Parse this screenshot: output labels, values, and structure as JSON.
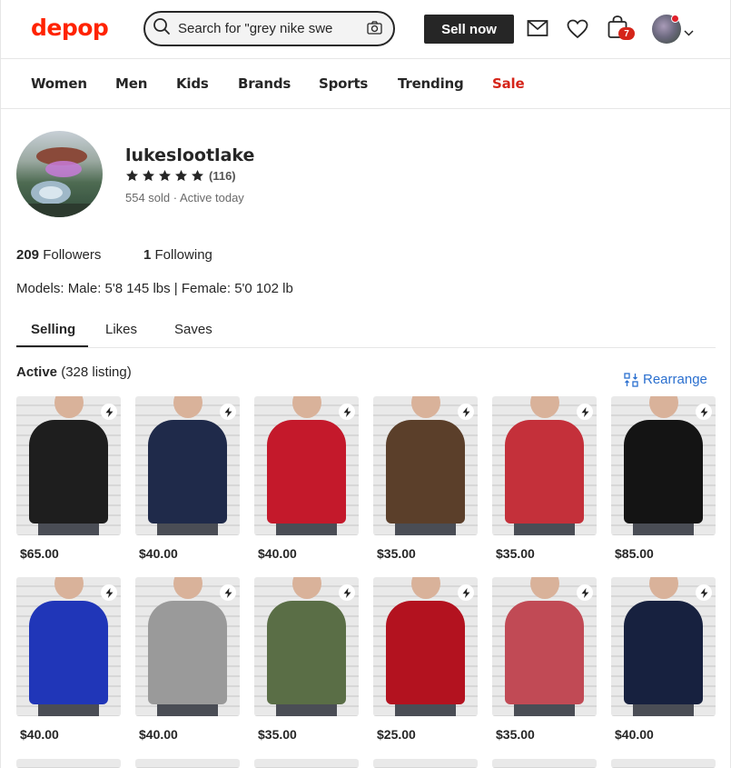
{
  "header": {
    "logo": "depop",
    "search_placeholder": "Search for \"grey nike swe",
    "sell_label": "Sell now",
    "bag_count": "7"
  },
  "categories": [
    {
      "label": "Women"
    },
    {
      "label": "Men"
    },
    {
      "label": "Kids"
    },
    {
      "label": "Brands"
    },
    {
      "label": "Sports"
    },
    {
      "label": "Trending"
    },
    {
      "label": "Sale"
    }
  ],
  "profile": {
    "username": "lukeslootlake",
    "rating_stars": 5,
    "rating_count": "(116)",
    "sold_line": "554 sold · Active today",
    "followers_count": "209",
    "followers_label": "Followers",
    "following_count": "1",
    "following_label": "Following",
    "bio": "Models: Male: 5'8 145 lbs | Female: 5'0 102 lb"
  },
  "tabs": [
    "Selling",
    "Likes",
    "Saves"
  ],
  "listing": {
    "active_label": "Active",
    "count_text": "(328 listing)",
    "rearrange_label": "Rearrange"
  },
  "products": [
    {
      "price": "$65.00",
      "color": "#1e1e1e"
    },
    {
      "price": "$40.00",
      "color": "#1f2a4a"
    },
    {
      "price": "$40.00",
      "color": "#c4192b"
    },
    {
      "price": "$35.00",
      "color": "#5b3f2a"
    },
    {
      "price": "$35.00",
      "color": "#c4303a"
    },
    {
      "price": "$85.00",
      "color": "#141414"
    },
    {
      "price": "$40.00",
      "color": "#2036b8"
    },
    {
      "price": "$40.00",
      "color": "#9a9a9a"
    },
    {
      "price": "$35.00",
      "color": "#5a6e46"
    },
    {
      "price": "$25.00",
      "color": "#b3121f"
    },
    {
      "price": "$35.00",
      "color": "#c14a55"
    },
    {
      "price": "$40.00",
      "color": "#17213f"
    }
  ]
}
